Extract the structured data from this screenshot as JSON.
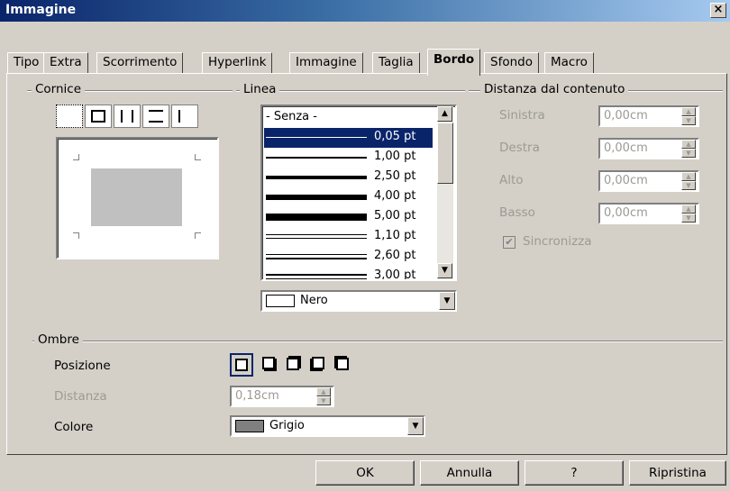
{
  "window": {
    "title": "Immagine",
    "close_glyph": "×"
  },
  "tabs": [
    {
      "label": "Tipo"
    },
    {
      "label": "Extra"
    },
    {
      "label": "Scorrimento"
    },
    {
      "label": "Hyperlink"
    },
    {
      "label": "Immagine"
    },
    {
      "label": "Taglia"
    },
    {
      "label": "Bordo",
      "active": true
    },
    {
      "label": "Sfondo"
    },
    {
      "label": "Macro"
    }
  ],
  "cornice": {
    "label": "Cornice"
  },
  "linea": {
    "label": "Linea",
    "items": [
      "- Senza -",
      "0,05 pt",
      "1,00 pt",
      "2,50 pt",
      "4,00 pt",
      "5,00 pt",
      "1,10 pt",
      "2,60 pt",
      "3,00 pt"
    ],
    "selected_index": 1,
    "color": {
      "value": "Nero",
      "hex": "#000000"
    }
  },
  "distanza": {
    "label": "Distanza dal contenuto",
    "fields": [
      {
        "label": "Sinistra",
        "value": "0,00cm"
      },
      {
        "label": "Destra",
        "value": "0,00cm"
      },
      {
        "label": "Alto",
        "value": "0,00cm"
      },
      {
        "label": "Basso",
        "value": "0,00cm"
      }
    ],
    "sync_label": "Sincronizza",
    "sync_checked": true
  },
  "ombre": {
    "label": "Ombre",
    "posizione_label": "Posizione",
    "distanza_label": "Distanza",
    "distanza_value": "0,18cm",
    "colore_label": "Colore",
    "colore_value": "Grigio",
    "colore_hex": "#808080"
  },
  "buttons": {
    "ok": "OK",
    "cancel": "Annulla",
    "help": "?",
    "reset": "Ripristina"
  },
  "colors": {
    "title_bar": "#0a246a",
    "dialog_bg": "#d4d0c8",
    "selection": "#0a246a"
  }
}
